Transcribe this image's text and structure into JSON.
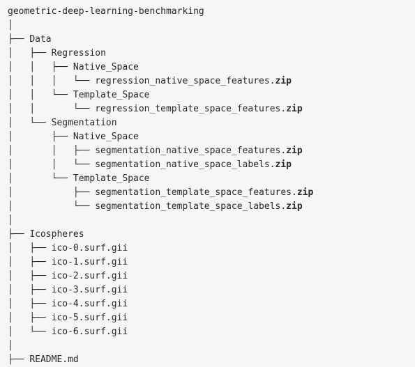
{
  "document": {
    "kind": "directory-tree",
    "root_label": "geometric-deep-learning-benchmarking",
    "colors": {
      "background": "#f6f6f6",
      "text": "#24292e"
    },
    "glyphs": {
      "tee": "├── ",
      "elbow": "└── ",
      "pipe": "│",
      "pipe_indent": "│   ",
      "blank_indent": "    "
    }
  },
  "lines": [
    {
      "prefix": "",
      "name": "geometric-deep-learning-benchmarking",
      "ext": ""
    },
    {
      "prefix": "│",
      "name": "",
      "ext": ""
    },
    {
      "prefix": "├── ",
      "name": "Data",
      "ext": ""
    },
    {
      "prefix": "│   ├── ",
      "name": "Regression",
      "ext": ""
    },
    {
      "prefix": "│   │   ├── ",
      "name": "Native_Space",
      "ext": ""
    },
    {
      "prefix": "│   │   │   └── ",
      "name": "regression_native_space_features.",
      "ext": "zip"
    },
    {
      "prefix": "│   │   └── ",
      "name": "Template_Space",
      "ext": ""
    },
    {
      "prefix": "│   │       └── ",
      "name": "regression_template_space_features.",
      "ext": "zip"
    },
    {
      "prefix": "│   └── ",
      "name": "Segmentation",
      "ext": ""
    },
    {
      "prefix": "│       ├── ",
      "name": "Native_Space",
      "ext": ""
    },
    {
      "prefix": "│       │   ├── ",
      "name": "segmentation_native_space_features.",
      "ext": "zip"
    },
    {
      "prefix": "│       │   └── ",
      "name": "segmentation_native_space_labels.",
      "ext": "zip"
    },
    {
      "prefix": "│       └── ",
      "name": "Template_Space",
      "ext": ""
    },
    {
      "prefix": "│           ├── ",
      "name": "segmentation_template_space_features.",
      "ext": "zip"
    },
    {
      "prefix": "│           └── ",
      "name": "segmentation_template_space_labels.",
      "ext": "zip"
    },
    {
      "prefix": "│",
      "name": "",
      "ext": ""
    },
    {
      "prefix": "├── ",
      "name": "Icospheres",
      "ext": ""
    },
    {
      "prefix": "│   ├── ",
      "name": "ico-0.surf.gii",
      "ext": ""
    },
    {
      "prefix": "│   ├── ",
      "name": "ico-1.surf.gii",
      "ext": ""
    },
    {
      "prefix": "│   ├── ",
      "name": "ico-2.surf.gii",
      "ext": ""
    },
    {
      "prefix": "│   ├── ",
      "name": "ico-3.surf.gii",
      "ext": ""
    },
    {
      "prefix": "│   ├── ",
      "name": "ico-4.surf.gii",
      "ext": ""
    },
    {
      "prefix": "│   ├── ",
      "name": "ico-5.surf.gii",
      "ext": ""
    },
    {
      "prefix": "│   └── ",
      "name": "ico-6.surf.gii",
      "ext": ""
    },
    {
      "prefix": "│",
      "name": "",
      "ext": ""
    },
    {
      "prefix": "├── ",
      "name": "README.md",
      "ext": ""
    }
  ]
}
